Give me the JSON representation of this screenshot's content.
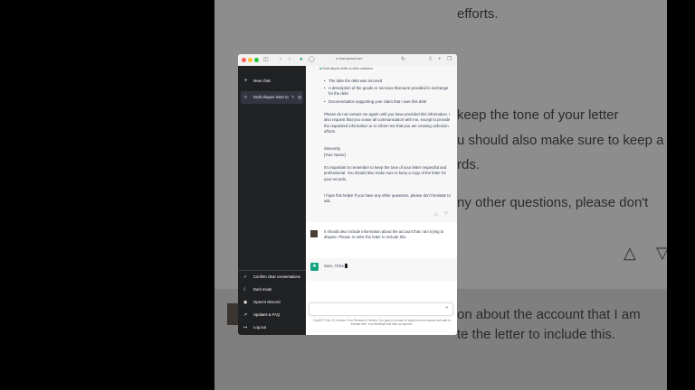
{
  "background": {
    "lines": [
      "efforts.",
      "keep the tone of your letter",
      "u should also make sure to keep a",
      "rds.",
      "ny other questions, please don't",
      "on about the account that I am",
      "te the letter to include this."
    ]
  },
  "browser": {
    "url": "chat.openai.com",
    "colors": {
      "close": "#ff5f57",
      "minimize": "#febc2e",
      "maximize": "#28c840"
    }
  },
  "sidebar": {
    "new_chat_label": "New chat",
    "active_chat_label": "Draft dispute letter to",
    "bottom_items": [
      {
        "icon": "trash-icon",
        "label": "Confirm clear conversations"
      },
      {
        "icon": "moon-icon",
        "label": "Dark mode"
      },
      {
        "icon": "discord-icon",
        "label": "OpenAI Discord"
      },
      {
        "icon": "external-link-icon",
        "label": "Updates & FAQ"
      },
      {
        "icon": "logout-icon",
        "label": "Log out"
      }
    ]
  },
  "conversation": {
    "title": "Draft dispute letter to debt collection",
    "bullets": [
      "The date the debt was incurred",
      "A description of the goods or services that were provided in exchange for the debt",
      "Documentation supporting your claim that I owe this debt"
    ],
    "paragraphs": [
      "Please do not contact me again until you have provided this information. I also request that you cease all communication with me, except to provide the requested information or to inform me that you are ceasing collection efforts.",
      "Sincerely,",
      "[Your Name]",
      "It's important to remember to keep the tone of your letter respectful and professional. You should also make sure to keep a copy of the letter for your records.",
      "I hope this helps! If you have any other questions, please don't hesitate to ask."
    ],
    "user_message": "It should also include information about the account that I am trying to dispute.  Please re-write the letter to include this.",
    "assistant_reply": "Sure, I'd be"
  },
  "composer": {
    "disclaimer": "ChatGPT Dec 15 Version. Free Research Preview. Our goal is to make AI systems more natural and safe to interact with. Your feedback will help us improve."
  }
}
